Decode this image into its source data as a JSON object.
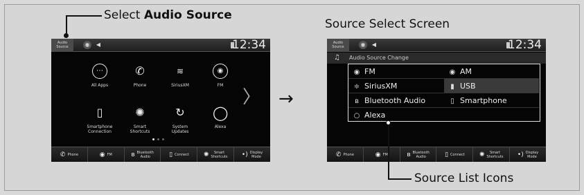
{
  "callouts": {
    "select_prefix": "Select ",
    "select_bold": "Audio Source",
    "screen_title": "Source Select Screen",
    "source_list_icons": "Source List Icons",
    "arrow": "→"
  },
  "status": {
    "audio_source_line1": "Audio",
    "audio_source_line2": "Source",
    "clock": "12:34"
  },
  "home": {
    "apps": [
      {
        "label": "All Apps",
        "icon": "grid-icon",
        "glyph": "⋯"
      },
      {
        "label": "Phone",
        "icon": "phone-icon",
        "glyph": "📞"
      },
      {
        "label": "SiriusXM",
        "icon": "siriusxm-icon",
        "glyph": "≋"
      },
      {
        "label": "FM",
        "icon": "radio-icon",
        "glyph": "◉"
      },
      {
        "label1": "Smartphone",
        "label2": "Connection",
        "icon": "smartphone-icon",
        "glyph": "▯"
      },
      {
        "label1": "Smart",
        "label2": "Shortcuts",
        "icon": "shortcuts-icon",
        "glyph": "✺"
      },
      {
        "label1": "System",
        "label2": "Updates",
        "icon": "refresh-icon",
        "glyph": "↻"
      },
      {
        "label": "Alexa",
        "icon": "alexa-icon",
        "glyph": "◯"
      }
    ],
    "chevron": "〉"
  },
  "bottom_bar": {
    "phone": "Phone",
    "fm": "FM",
    "bluetooth1": "Bluetooth",
    "bluetooth2": "Audio",
    "connect": "Connect",
    "smart1": "Smart",
    "smart2": "Shortcuts",
    "display1": "Display",
    "display2": "Mode"
  },
  "source_screen": {
    "header": "Audio Source Change",
    "sources": [
      {
        "label": "FM",
        "icon": "radio-icon",
        "glyph": "◉"
      },
      {
        "label": "AM",
        "icon": "radio-icon",
        "glyph": "◉"
      },
      {
        "label": "SiriusXM",
        "icon": "siriusxm-icon",
        "glyph": "≑"
      },
      {
        "label": "USB",
        "icon": "usb-icon",
        "glyph": "▮"
      },
      {
        "label": "Bluetooth Audio",
        "icon": "bluetooth-icon",
        "glyph": "ʙ"
      },
      {
        "label": "Smartphone",
        "icon": "smartphone-icon",
        "glyph": "▯"
      },
      {
        "label": "Alexa",
        "icon": "alexa-icon",
        "glyph": "○"
      }
    ]
  }
}
